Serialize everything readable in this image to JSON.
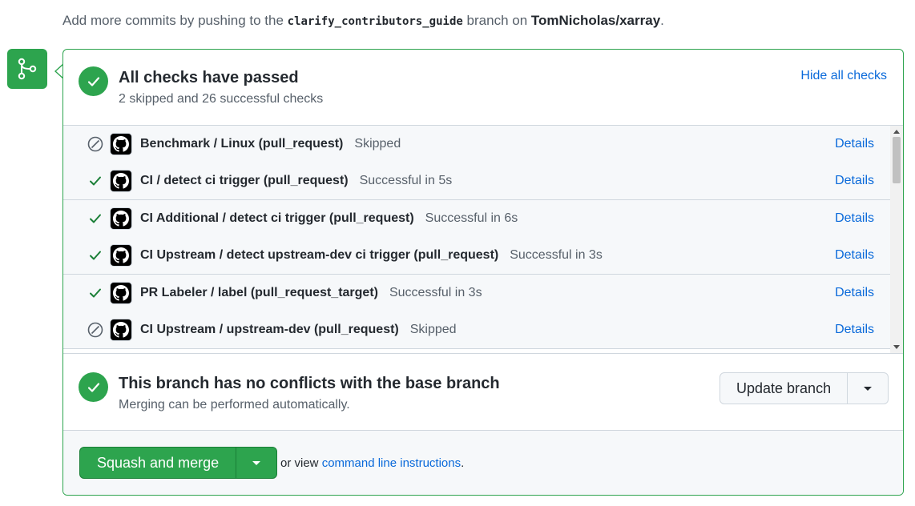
{
  "notice": {
    "prefix": "Add more commits by pushing to the",
    "branch": "clarify_contributors_guide",
    "middle": "branch on",
    "repo": "TomNicholas/xarray",
    "suffix": "."
  },
  "checks_summary": {
    "title": "All checks have passed",
    "subtitle": "2 skipped and 26 successful checks",
    "toggle_label": "Hide all checks"
  },
  "checks": [
    {
      "state": "skipped",
      "name": "Benchmark / Linux (pull_request)",
      "status": "Skipped",
      "details": "Details"
    },
    {
      "state": "success",
      "name": "CI / detect ci trigger (pull_request)",
      "status": "Successful in 5s",
      "details": "Details"
    },
    {
      "state": "success",
      "name": "CI Additional / detect ci trigger (pull_request)",
      "status": "Successful in 6s",
      "details": "Details"
    },
    {
      "state": "success",
      "name": "CI Upstream / detect upstream-dev ci trigger (pull_request)",
      "status": "Successful in 3s",
      "details": "Details"
    },
    {
      "state": "success",
      "name": "PR Labeler / label (pull_request_target)",
      "status": "Successful in 3s",
      "details": "Details"
    },
    {
      "state": "skipped",
      "name": "CI Upstream / upstream-dev (pull_request)",
      "status": "Skipped",
      "details": "Details"
    }
  ],
  "conflicts": {
    "title": "This branch has no conflicts with the base branch",
    "subtitle": "Merging can be performed automatically.",
    "update_button": "Update branch"
  },
  "merge": {
    "button_label": "Squash and merge",
    "footer_prefix": "or view",
    "footer_link": "command line instructions",
    "footer_suffix": "."
  },
  "colors": {
    "success": "#2da44e",
    "link": "#0969da",
    "muted": "#57606a"
  }
}
